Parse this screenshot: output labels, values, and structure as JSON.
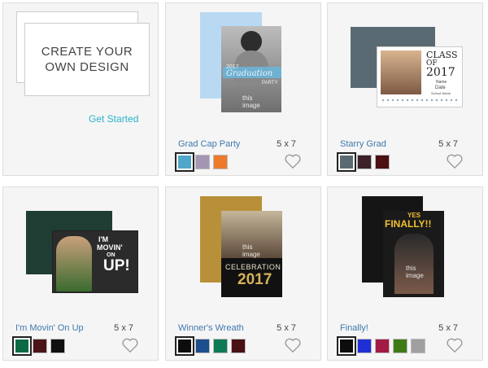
{
  "create": {
    "title_line1": "CREATE YOUR",
    "title_line2": "OWN DESIGN",
    "cta": "Get Started"
  },
  "products": [
    {
      "name": "Grad Cap Party",
      "size": "5 x 7",
      "swatches": [
        "#4fa6c8",
        "#a596b4",
        "#ee7a2c"
      ],
      "selected": 0,
      "photo": {
        "line1": "this",
        "line2": "image",
        "year": "2017",
        "script": "Graduation",
        "tag": "PARTY"
      }
    },
    {
      "name": "Starry Grad",
      "size": "5 x 7",
      "swatches": [
        "#5a6a72",
        "#3b2128",
        "#4c0f12"
      ],
      "selected": 0,
      "photo": {
        "class_of": "CLASS",
        "of": "OF",
        "year": "2017",
        "name": "Name",
        "date": "Date",
        "school": "School Name"
      }
    },
    {
      "name": "I'm Movin' On Up",
      "size": "5 x 7",
      "swatches": [
        "#0a6a43",
        "#4c1418",
        "#101010"
      ],
      "selected": 0,
      "photo": {
        "line1": "I'M",
        "line2": "MOVIN'",
        "line3": "ON",
        "line4": "UP!"
      }
    },
    {
      "name": "Winner's Wreath",
      "size": "5 x 7",
      "swatches": [
        "#0d0d0d",
        "#1c4f8c",
        "#0b7a55",
        "#4a1114"
      ],
      "selected": 0,
      "photo": {
        "line1": "this",
        "line2": "image",
        "word": "CELEBRATION",
        "year": "2017"
      }
    },
    {
      "name": "Finally!",
      "size": "5 x 7",
      "swatches": [
        "#0d0d0d",
        "#1f2fd6",
        "#a31a44",
        "#3e7a17",
        "#a0a0a0"
      ],
      "selected": 0,
      "photo": {
        "line1": "this",
        "line2": "image",
        "yes": "YES",
        "finally": "FINALLY!!"
      }
    }
  ]
}
